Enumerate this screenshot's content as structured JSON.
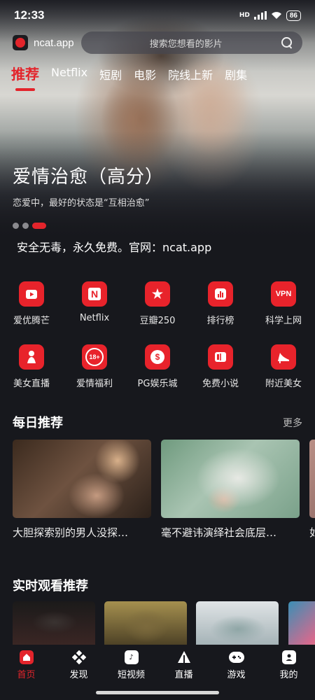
{
  "status_bar": {
    "time": "12:33",
    "network": "HD",
    "battery": "86"
  },
  "header": {
    "brand": "ncat.app",
    "search_placeholder": "搜索您想看的影片"
  },
  "tabs": [
    "推荐",
    "Netflix",
    "短剧",
    "电影",
    "院线上新",
    "剧集"
  ],
  "active_tab": "推荐",
  "banner": {
    "title": "爱情治愈（高分）",
    "subtitle": "恋爱中，最好的状态是“互相治愈”",
    "slide_count": 3,
    "active_slide": 3
  },
  "notice": "安全无毒，永久免费。官网：ncat.app",
  "shortcuts": [
    {
      "label": "爱优腾芒",
      "icon": "play-app-icon"
    },
    {
      "label": "Netflix",
      "icon": "netflix-n-icon",
      "glyph": "N"
    },
    {
      "label": "豆瓣250",
      "icon": "star-ribbon-icon",
      "glyph": "★"
    },
    {
      "label": "排行榜",
      "icon": "bar-chart-icon"
    },
    {
      "label": "科学上网",
      "icon": "vpn-icon",
      "glyph": "VPN"
    },
    {
      "label": "美女直播",
      "icon": "woman-silhouette-icon"
    },
    {
      "label": "爱情福利",
      "icon": "18-plus-icon",
      "glyph": "18+"
    },
    {
      "label": "PG娱乐城",
      "icon": "coin-icon",
      "glyph": "$"
    },
    {
      "label": "免费小说",
      "icon": "book-icon"
    },
    {
      "label": "附近美女",
      "icon": "high-heel-icon"
    }
  ],
  "daily": {
    "title": "每日推荐",
    "more": "更多",
    "items": [
      {
        "caption": "大胆探索别的男人没探…"
      },
      {
        "caption": "毫不避讳演绎社会底层…"
      },
      {
        "caption": "如"
      }
    ]
  },
  "live_watch": {
    "title": "实时观看推荐"
  },
  "bottom_nav": [
    {
      "label": "首页",
      "icon": "home-icon"
    },
    {
      "label": "发现",
      "icon": "discover-icon"
    },
    {
      "label": "短视频",
      "icon": "music-note-icon"
    },
    {
      "label": "直播",
      "icon": "broadcast-icon"
    },
    {
      "label": "游戏",
      "icon": "gamepad-icon"
    },
    {
      "label": "我的",
      "icon": "profile-icon"
    }
  ],
  "active_nav": "首页",
  "colors": {
    "accent": "#e3242b",
    "background": "#17181d"
  }
}
